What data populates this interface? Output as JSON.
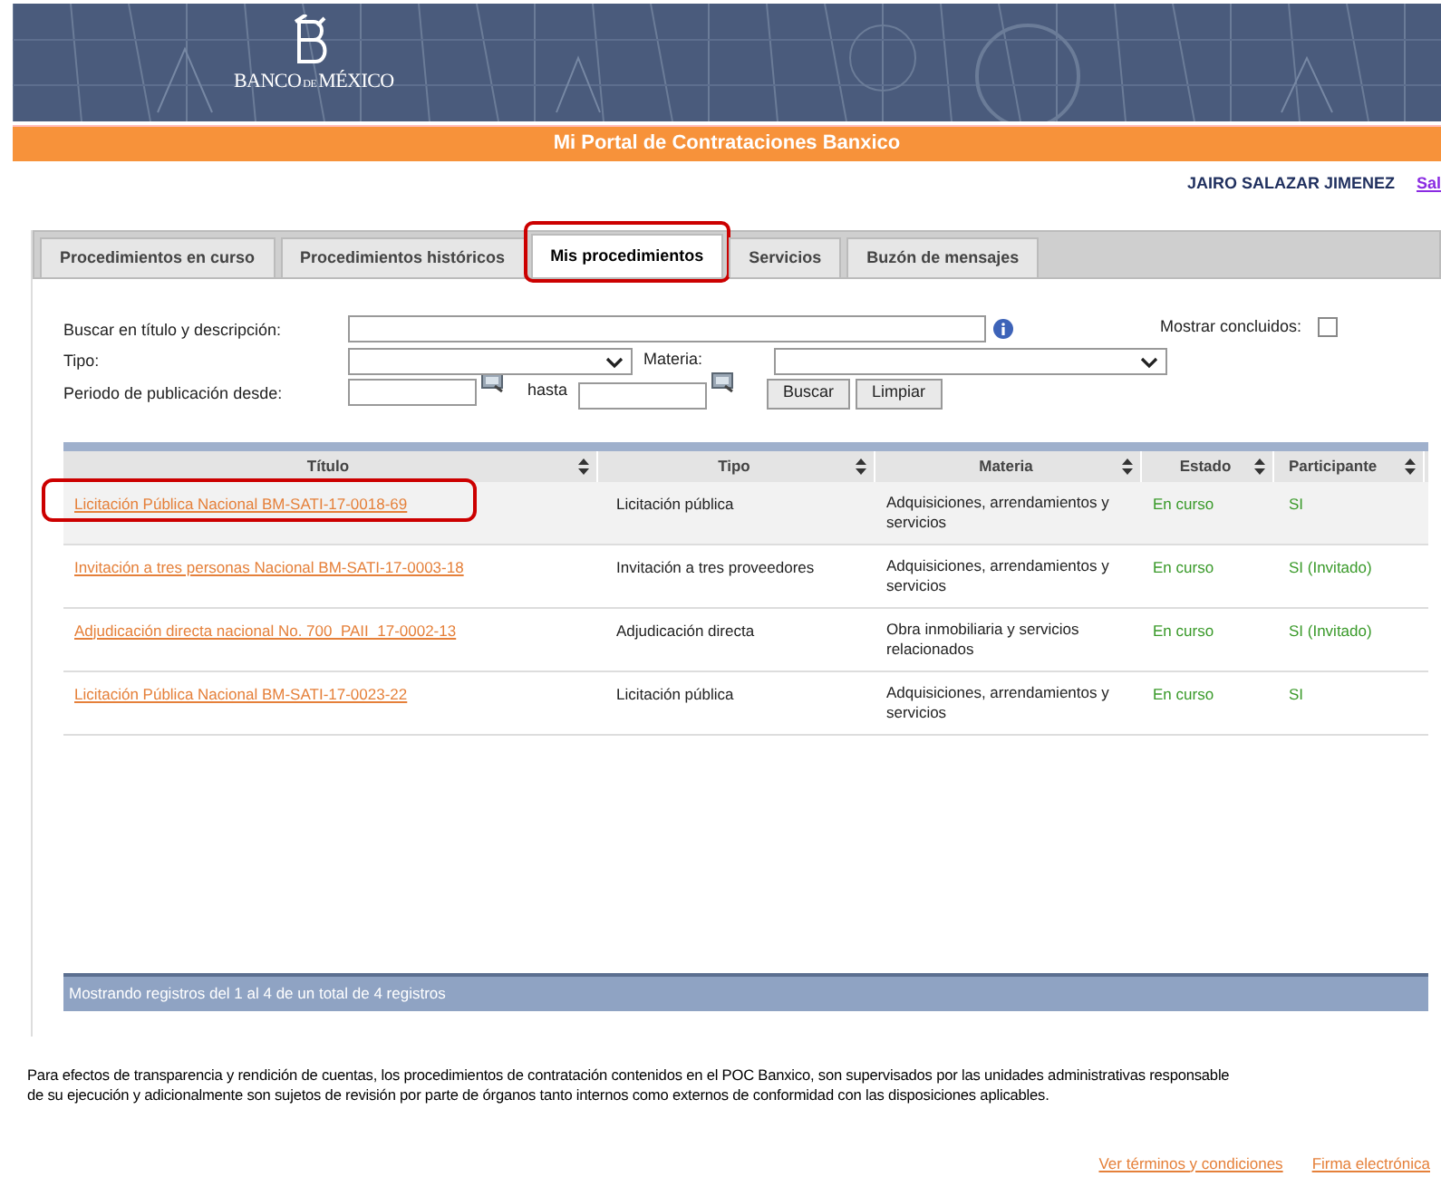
{
  "header": {
    "logo_parts": [
      "BANCO",
      "DE",
      "MÉXICO"
    ],
    "portal_title": "Mi Portal de Contrataciones Banxico"
  },
  "user": {
    "name": "JAIRO SALAZAR JIMENEZ",
    "link": "Sal"
  },
  "tabs": [
    {
      "label": "Procedimientos en curso",
      "selected": false,
      "highlighted": false
    },
    {
      "label": "Procedimientos históricos",
      "selected": false,
      "highlighted": false
    },
    {
      "label": "Mis procedimientos",
      "selected": true,
      "highlighted": true
    },
    {
      "label": "Servicios",
      "selected": false,
      "highlighted": false
    },
    {
      "label": "Buzón de mensajes",
      "selected": false,
      "highlighted": false
    }
  ],
  "filters": {
    "search_label": "Buscar en título y descripción:",
    "show_closed_label": "Mostrar concluidos:",
    "show_closed": false,
    "tipo_label": "Tipo:",
    "materia_label": "Materia:",
    "period_label": "Periodo de publicación desde:",
    "hasta_label": "hasta",
    "buttons": [
      "Buscar",
      "Limpiar"
    ]
  },
  "table": {
    "columns": [
      "Título",
      "Tipo",
      "Materia",
      "Estado",
      "Participante"
    ],
    "rows": [
      {
        "titulo": "Licitación Pública Nacional BM-SATI-17-0018-69",
        "tipo": "Licitación pública",
        "materia": "Adquisiciones, arrendamientos y servicios",
        "estado": "En curso",
        "participante": "SI",
        "highlighted": true
      },
      {
        "titulo": "Invitación a tres personas Nacional BM-SATI-17-0003-18",
        "tipo": "Invitación a tres proveedores",
        "materia": "Adquisiciones, arrendamientos y servicios",
        "estado": "En curso",
        "participante": "SI (Invitado)",
        "highlighted": false
      },
      {
        "titulo": "Adjudicación directa nacional No. 700_PAII_17-0002-13",
        "tipo": "Adjudicación directa",
        "materia": "Obra inmobiliaria y servicios relacionados",
        "estado": "En curso",
        "participante": "SI (Invitado)",
        "highlighted": false
      },
      {
        "titulo": "Licitación Pública Nacional BM-SATI-17-0023-22",
        "tipo": "Licitación pública",
        "materia": "Adquisiciones, arrendamientos y servicios",
        "estado": "En curso",
        "participante": "SI",
        "highlighted": false
      }
    ],
    "footer": "Mostrando registros del 1 al 4 de un total de 4 registros"
  },
  "disclaimer": [
    "Para efectos de transparencia y rendición de cuentas, los procedimientos de contratación contenidos en el POC Banxico, son supervisados por las unidades administrativas responsable",
    "de su ejecución y adicionalmente son sujetos de revisión por parte de órganos tanto internos como externos de conformidad con las disposiciones aplicables."
  ],
  "footer_links": [
    "Ver términos y condiciones",
    "Firma electrónica"
  ]
}
